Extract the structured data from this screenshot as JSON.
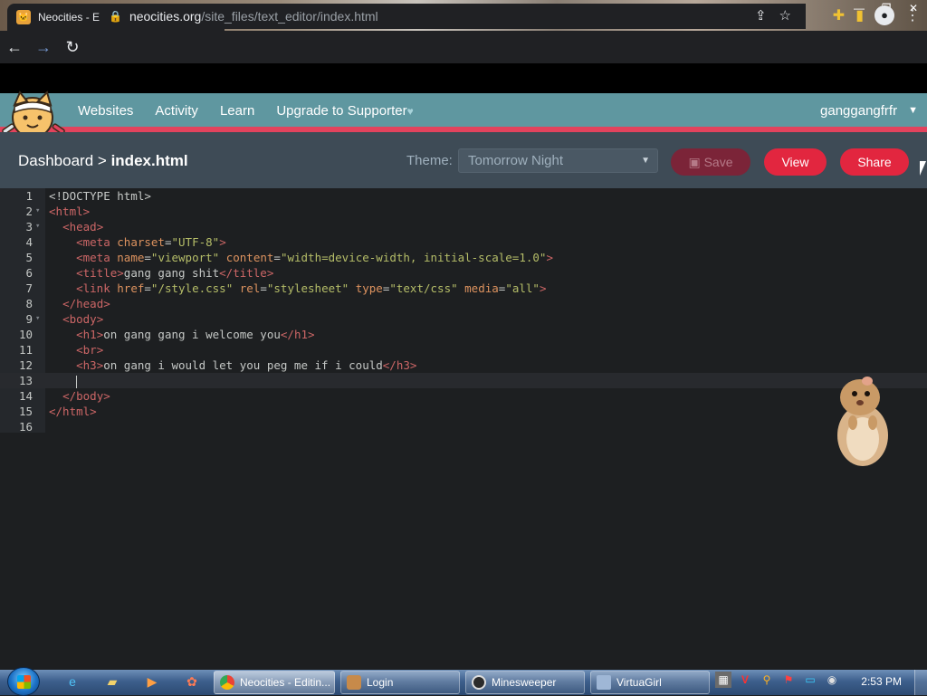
{
  "browser": {
    "tab_title": "Neocities - Editing index.html",
    "url_domain": "neocities.org",
    "url_path": "/site_files/text_editor/index.html"
  },
  "nav": {
    "items": [
      "Websites",
      "Activity",
      "Learn",
      "Upgrade to Supporter"
    ],
    "username": "ganggangfrfr"
  },
  "editor_bar": {
    "crumb_root": "Dashboard",
    "crumb_sep": ">",
    "crumb_file": "index.html",
    "theme_label": "Theme:",
    "theme_value": "Tomorrow Night",
    "save_label": "Save",
    "view_label": "View",
    "share_label": "Share"
  },
  "code_lines": [
    "<!DOCTYPE html>",
    "<html>",
    "  <head>",
    "    <meta charset=\"UTF-8\">",
    "    <meta name=\"viewport\" content=\"width=device-width, initial-scale=1.0\">",
    "    <title>gang gang shit</title>",
    "    <link href=\"/style.css\" rel=\"stylesheet\" type=\"text/css\" media=\"all\">",
    "  </head>",
    "  <body>",
    "    <h1>on gang gang i welcome you</h1>",
    "    <br>",
    "    <h3>on gang i would let you peg me if i could</h3>",
    "    ",
    "  </body>",
    "</html>",
    ""
  ],
  "line_numbers": [
    "1",
    "2",
    "3",
    "4",
    "5",
    "6",
    "7",
    "8",
    "9",
    "10",
    "11",
    "12",
    "13",
    "14",
    "15",
    "16"
  ],
  "taskbar": {
    "tasks": [
      "Neocities - Editin...",
      "Login",
      "Minesweeper",
      "VirtuaGirl"
    ],
    "clock": "2:53 PM"
  },
  "colors": {
    "nc_header": "#5f97a0",
    "nc_accent": "#e2435d",
    "editor_bg": "#1d1f21",
    "button_red": "#e2263f"
  }
}
